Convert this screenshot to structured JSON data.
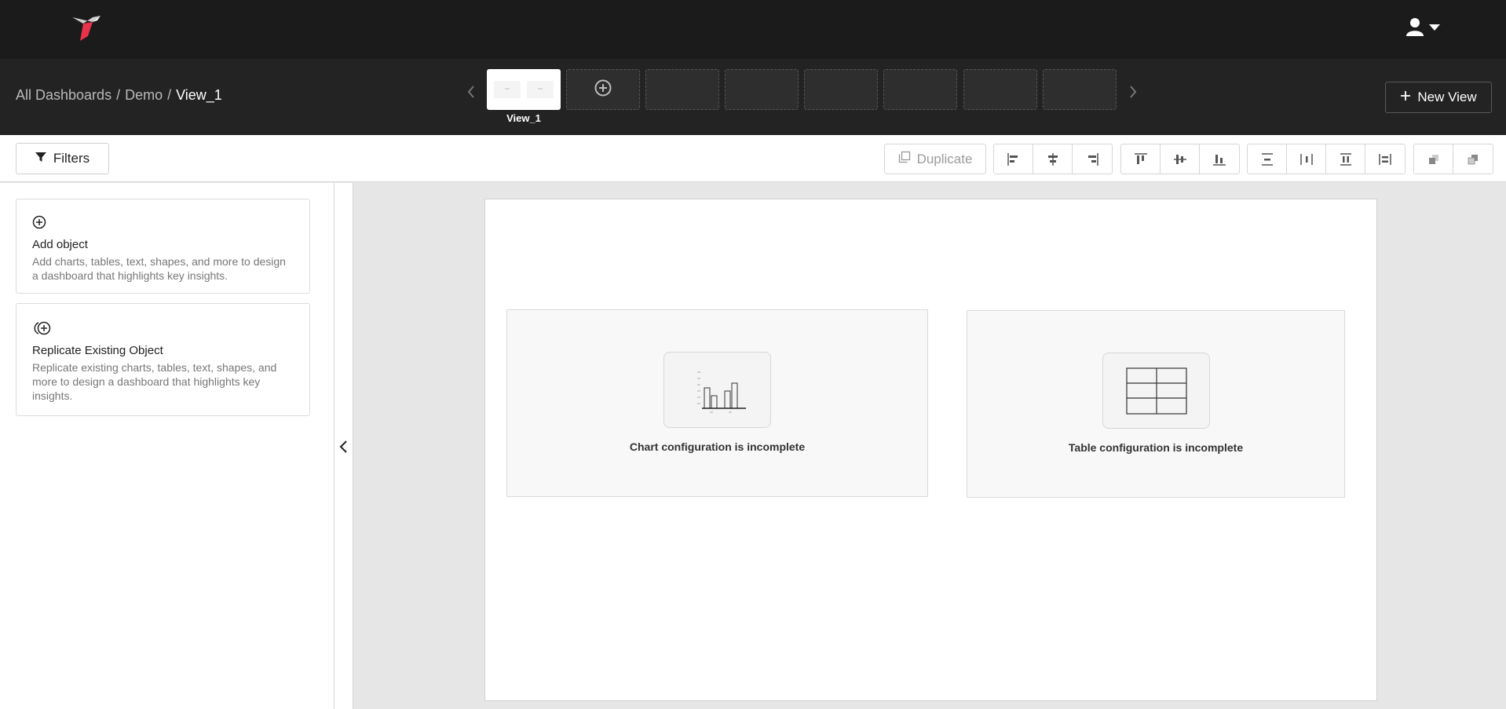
{
  "header": {
    "logo_icon": "hummingbird-logo-icon",
    "user_icon": "user-icon",
    "menu_icon": "caret-down-icon"
  },
  "viewbar": {
    "breadcrumb": {
      "root": "All Dashboards",
      "separator": "/",
      "dashboard": "Demo",
      "current": "View_1"
    },
    "active_view_label": "View_1",
    "new_view_label": "New View",
    "add_view_icon": "plus-circle-icon"
  },
  "toolbar": {
    "filters_label": "Filters",
    "duplicate_label": "Duplicate",
    "align_horizontal": [
      "align-left-icon",
      "align-center-horizontal-icon",
      "align-right-icon"
    ],
    "align_vertical": [
      "align-top-icon",
      "align-middle-icon",
      "align-bottom-icon"
    ],
    "distribute": [
      "distribute-vertical-icon",
      "distribute-horizontal-icon",
      "space-vertical-icon",
      "space-horizontal-icon"
    ],
    "layer": [
      "bring-to-front-icon",
      "send-to-back-icon"
    ]
  },
  "sidebar": {
    "cards": [
      {
        "title": "Add object",
        "description": "Add charts, tables, text, shapes, and more to design a dashboard that highlights key insights.",
        "icon": "plus-circle-icon"
      },
      {
        "title": "Replicate Existing Object",
        "description": "Replicate existing charts, tables, text, shapes, and more to design a dashboard that highlights key insights.",
        "icon": "replicate-icon"
      }
    ]
  },
  "canvas": {
    "chart_widget": {
      "message": "Chart configuration is incomplete",
      "icon": "bar-chart-icon"
    },
    "table_widget": {
      "message": "Table configuration is incomplete",
      "icon": "table-icon"
    }
  },
  "colors": {
    "topbar": "#1b1b1b",
    "viewbar": "#232323",
    "accent": "#e8324a",
    "canvas_bg": "#e6e6e6"
  }
}
